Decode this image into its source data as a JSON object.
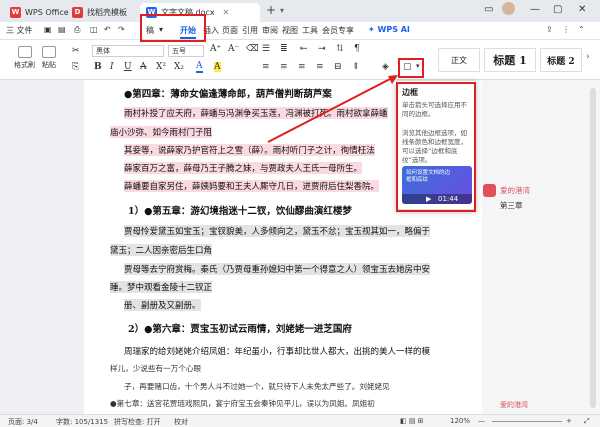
{
  "tabs": [
    {
      "label": "WPS Office",
      "icon": "W",
      "color": "#e23b3b"
    },
    {
      "label": "找稻壳模板",
      "icon": "D",
      "color": "#e23b3b"
    },
    {
      "label": "文字文稿.docx",
      "icon": "W",
      "color": "#2b66e8"
    }
  ],
  "new_tab": "+",
  "menu": {
    "file": "三 文件",
    "items": [
      "稿",
      "开始",
      "插入",
      "页面",
      "引用",
      "审阅",
      "视图",
      "工具",
      "会员专享"
    ],
    "wps_ai": "WPS AI"
  },
  "ribbon": {
    "format_painter": "格式刷",
    "paste": "粘贴",
    "font": "黑体",
    "size": "五号",
    "glyphs": [
      "B",
      "I",
      "U",
      "A",
      "X²",
      "X₂",
      "A",
      "A"
    ],
    "styles": [
      {
        "label": "正文"
      },
      {
        "label": "标题 1"
      },
      {
        "label": "标题 2"
      }
    ]
  },
  "document": {
    "lines": [
      {
        "text": "●第四章：薄命女偏逢薄命郎，葫芦僧判断葫芦案",
        "style": "bold"
      },
      {
        "text": "雨村补授了应天府，薛蟠与冯渊争买玉莲，冯渊被打死。雨村欲拿薛蟠",
        "style": "hlpink"
      },
      {
        "text": "庙小沙弥、如今雨村门子阻",
        "style": "hlpink"
      },
      {
        "text": "其妾等，说薛家乃护官符上之雪（薛）。雨村听门子之计，徇情枉法",
        "style": "hlpink"
      },
      {
        "text": "薛家百万之富，薛母乃王子腾之妹，与贾政夫人王氏一母所生。",
        "style": "hlpink"
      },
      {
        "text": "薛蟠要自家另住，薛姨妈要和王夫人厮守几日，进贾府后住梨香院。",
        "style": "hlpink"
      },
      {
        "text": "1）●第五章：游幻境指迷十二钗，饮仙醪曲演红楼梦",
        "style": "bold"
      },
      {
        "text": "贾母怜爱黛玉如宝玉；宝钗貌美，人多倾向之，黛玉不忿；宝玉视其如一，略偏于",
        "style": "hl"
      },
      {
        "text": "黛玉；二人因亲密后生口角",
        "style": "hl"
      },
      {
        "text": "贾母等去宁府赏梅。秦氏（乃贾母重孙媳妇中第一个得意之人）领宝玉去她房中安",
        "style": "hl"
      },
      {
        "text": "睡。梦中观看金陵十二钗正",
        "style": "hl"
      },
      {
        "text": "册、副册及又副册。",
        "style": "hl"
      },
      {
        "text": "2）●第六章：贾宝玉初试云雨情，刘姥姥一进芝国府",
        "style": "bold"
      },
      {
        "text": "周瑞家的给刘姥姥介绍凤姐：年纪虽小，行事却比世人都大，出挑的美人一样的模",
        "style": "normal"
      },
      {
        "text": "样儿，少说些有一万个心眼",
        "style": "small"
      },
      {
        "text": "子，再要赌口齿，十个男人斗不过她一个，就只待下人未免太严些了。刘姥姥见",
        "style": "small"
      },
      {
        "text": "●第七章：送宫花贾琏戏熙凤，宴宁府宝玉会秦钟见平儿，误以为凤姐。凤姐初",
        "style": "small"
      }
    ]
  },
  "popup": {
    "title": "边框",
    "desc1": "单击箭头可选择应用不同的边框。",
    "desc2": "浏览其他边框选项，如线条颜色和边框宽度，可以选择“边框和底纹”选项。",
    "video_title": "如何设置文档的边框和底纹",
    "video_time": "01:44"
  },
  "comment": {
    "author": "爱的港湾",
    "text": "第三章",
    "author2": "爱的港湾"
  },
  "status": {
    "page": "页面: 3/4",
    "words": "字数: 105/1315",
    "spell": "拼写检查: 打开",
    "proof": "校对",
    "zoom": "120%"
  },
  "colors": {
    "accent": "#1c62e6",
    "annotation": "#e02020",
    "comment": "#e0505a"
  }
}
